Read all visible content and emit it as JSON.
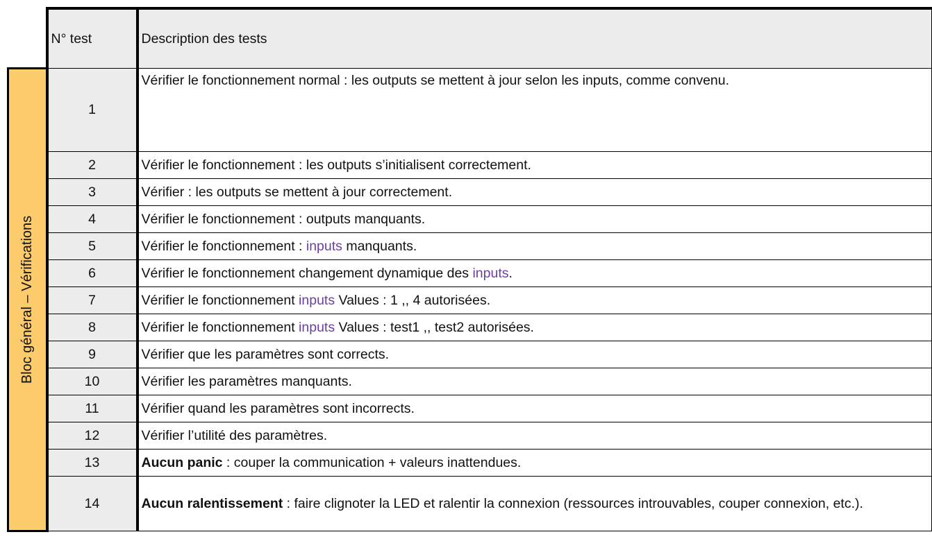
{
  "header": {
    "num": "N° test",
    "desc": "Description des tests"
  },
  "side_label": "Bloc général – Vérifications",
  "rows": [
    {
      "num": "1",
      "desc": "Vérifier le fonctionnement normal : les outputs se mettent à jour selon les inputs, comme convenu."
    },
    {
      "num": "2",
      "desc": "Vérifier le fonctionnement : les outputs s’initialisent correctement."
    },
    {
      "num": "3",
      "desc": "Vérifier : les outputs se mettent à jour correctement."
    },
    {
      "num": "4",
      "desc": "Vérifier le fonctionnement : outputs manquants."
    },
    {
      "num": "5",
      "pre": "Vérifier le fonctionnement : ",
      "kw": "inputs",
      "post": " manquants."
    },
    {
      "num": "6",
      "pre": "Vérifier le fonctionnement changement dynamique des ",
      "kw": "inputs",
      "post": "."
    },
    {
      "num": "7",
      "pre": "Vérifier le fonctionnement ",
      "kw": "inputs",
      "post": " Values : 1  ,, 4 autorisées."
    },
    {
      "num": "8",
      "pre": "Vérifier le fonctionnement ",
      "kw": "inputs",
      "post": " Values : test1  ,, test2 autorisées."
    },
    {
      "num": "9",
      "desc": "Vérifier que les paramètres sont corrects."
    },
    {
      "num": "10",
      "desc": "Vérifier les paramètres manquants."
    },
    {
      "num": "11",
      "desc": "Vérifier quand les paramètres sont incorrects."
    },
    {
      "num": "12",
      "desc": "Vérifier l’utilité des paramètres."
    },
    {
      "num": "13",
      "bold": "Aucun panic",
      "post": " : couper la communication + valeurs inattendues."
    },
    {
      "num": "14",
      "bold": "Aucun ralentissement",
      "post": " : faire clignoter la LED et ralentir la connexion (ressources introuvables, couper connexion, etc.)."
    }
  ],
  "colors": {
    "header_bg": "#ececec",
    "side_bg": "#fccb6b",
    "keyword": "#6b3fa0"
  }
}
